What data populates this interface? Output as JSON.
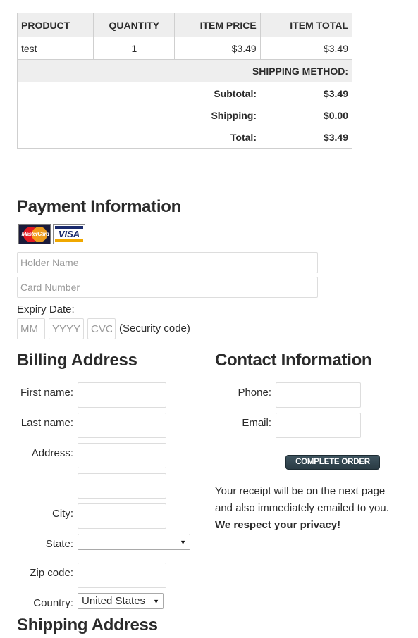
{
  "order_table": {
    "headers": [
      "PRODUCT",
      "QUANTITY",
      "ITEM PRICE",
      "ITEM TOTAL"
    ],
    "rows": [
      {
        "product": "test",
        "quantity": "1",
        "item_price": "$3.49",
        "item_total": "$3.49"
      }
    ],
    "shipping_method_label": "SHIPPING METHOD:",
    "summary": [
      {
        "label": "Subtotal:",
        "value": "$3.49"
      },
      {
        "label": "Shipping:",
        "value": "$0.00"
      },
      {
        "label": "Total:",
        "value": "$3.49"
      }
    ]
  },
  "payment": {
    "title": "Payment Information",
    "cards": [
      {
        "name": "mastercard-icon",
        "label": "MasterCard"
      },
      {
        "name": "visa-icon",
        "label": "VISA"
      }
    ],
    "holder_name_placeholder": "Holder Name",
    "card_number_placeholder": "Card Number",
    "expiry_label": "Expiry Date:",
    "month_placeholder": "MM",
    "year_placeholder": "YYYY",
    "cvc_placeholder": "CVC",
    "security_code_note": "(Security code)"
  },
  "billing": {
    "title": "Billing Address",
    "first_name_label": "First name:",
    "last_name_label": "Last name:",
    "address_label": "Address:",
    "city_label": "City:",
    "state_label": "State:",
    "state_value": "",
    "zip_label": "Zip code:",
    "country_label": "Country:",
    "country_value": "United States"
  },
  "contact": {
    "title": "Contact Information",
    "phone_label": "Phone:",
    "email_label": "Email:",
    "complete_button": "COMPLETE ORDER",
    "receipt_line1": "Your receipt will be on the next page",
    "receipt_line2": "and also immediately emailed to you.",
    "privacy_note": "We respect your privacy!"
  },
  "shipping": {
    "title": "Shipping Address"
  },
  "icons": {
    "dropdown_arrow": "▼"
  }
}
